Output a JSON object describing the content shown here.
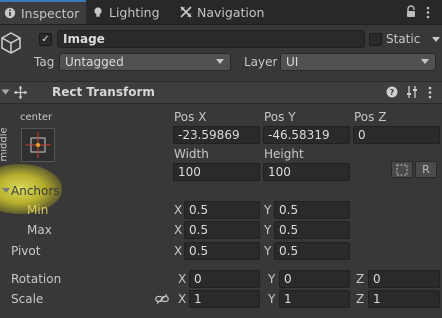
{
  "tabs": [
    {
      "label": "Inspector",
      "icon": "info-icon",
      "active": true
    },
    {
      "label": "Lighting",
      "icon": "bulb-icon",
      "active": false
    },
    {
      "label": "Navigation",
      "icon": "navigation-icon",
      "active": false
    }
  ],
  "header": {
    "object_name": "Image",
    "active_checked": true,
    "static_label": "Static",
    "tag_label": "Tag",
    "tag_value": "Untagged",
    "layer_label": "Layer",
    "layer_value": "UI"
  },
  "component": {
    "title": "Rect Transform",
    "anchor_preset_h": "center",
    "anchor_preset_v": "middle",
    "columns": {
      "c1": "Pos X",
      "c2": "Pos Y",
      "c3": "Pos Z"
    },
    "pos_x": "-23.59869",
    "pos_y": "-46.58319",
    "pos_z": "0",
    "width_label": "Width",
    "height_label": "Height",
    "width": "100",
    "height": "100",
    "raw_btn": "R",
    "anchors_label": "Anchors",
    "min_label": "Min",
    "max_label": "Max",
    "min_x": "0.5",
    "min_y": "0.5",
    "max_x": "0.5",
    "max_y": "0.5",
    "pivot_label": "Pivot",
    "pivot_x": "0.5",
    "pivot_y": "0.5",
    "rotation_label": "Rotation",
    "rot_x": "0",
    "rot_y": "0",
    "rot_z": "0",
    "scale_label": "Scale",
    "scale_x": "1",
    "scale_y": "1",
    "scale_z": "1",
    "axis_x": "X",
    "axis_y": "Y",
    "axis_z": "Z"
  },
  "colors": {
    "accent": "#3a79bb",
    "highlight": "#e8e030",
    "min_max_text": "#d7cf60"
  }
}
